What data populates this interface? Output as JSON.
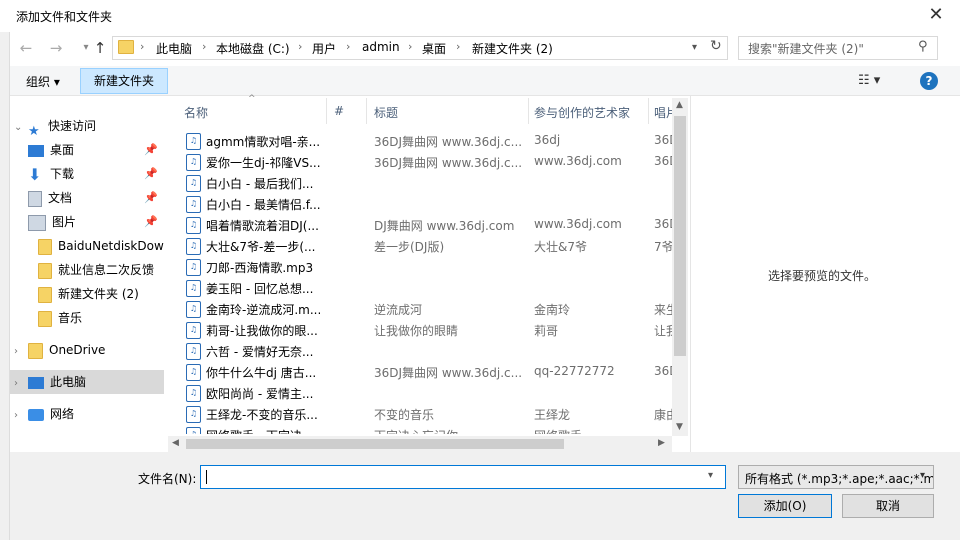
{
  "window": {
    "title": "添加文件和文件夹",
    "close_glyph": "✕"
  },
  "nav": {
    "back": "←",
    "forward": "→",
    "up": "↑",
    "refresh": "↻",
    "breadcrumb": [
      "此电脑",
      "本地磁盘 (C:)",
      "用户",
      "admin",
      "桌面",
      "新建文件夹 (2)"
    ],
    "search_placeholder": "搜索\"新建文件夹 (2)\""
  },
  "toolbar": {
    "organize": "组织 ▾",
    "new_folder": "新建文件夹",
    "view": "☷ ▾",
    "help": "?"
  },
  "sidebar": {
    "quick_access": "快速访问",
    "items": [
      {
        "label": "桌面",
        "icon": "desktop-icon",
        "pinned": true
      },
      {
        "label": "下载",
        "icon": "download-icon",
        "pinned": true
      },
      {
        "label": "文档",
        "icon": "document-icon",
        "pinned": true
      },
      {
        "label": "图片",
        "icon": "picture-icon",
        "pinned": true
      },
      {
        "label": "BaiduNetdiskDow",
        "icon": "folder-icon",
        "pinned": false
      },
      {
        "label": "就业信息二次反馈",
        "icon": "folder-icon",
        "pinned": false
      },
      {
        "label": "新建文件夹 (2)",
        "icon": "folder-icon",
        "pinned": false
      },
      {
        "label": "音乐",
        "icon": "folder-icon",
        "pinned": false
      }
    ],
    "onedrive": "OneDrive",
    "this_pc": "此电脑",
    "network": "网络",
    "pin_glyph": "📌"
  },
  "columns": {
    "name": "名称",
    "num": "#",
    "title": "标题",
    "artist": "参与创作的艺术家",
    "album": "唱片"
  },
  "files": [
    {
      "name": "agmm情歌对唱-亲...",
      "title": "36DJ舞曲网 www.36dj.c...",
      "artist": "36dj",
      "album": "36D"
    },
    {
      "name": "爱你一生dj-祁隆VS...",
      "title": "36DJ舞曲网 www.36dj.c...",
      "artist": "www.36dj.com",
      "album": "36D"
    },
    {
      "name": "白小白 - 最后我们...",
      "title": "",
      "artist": "",
      "album": ""
    },
    {
      "name": "白小白 - 最美情侣.f...",
      "title": "",
      "artist": "",
      "album": ""
    },
    {
      "name": "唱着情歌流着泪DJ(...",
      "title": "DJ舞曲网 www.36dj.com",
      "artist": "www.36dj.com",
      "album": "36D"
    },
    {
      "name": "大壮&7爷-差一步(...",
      "title": "差一步(DJ版)",
      "artist": "大壮&7爷",
      "album": "7爷"
    },
    {
      "name": "刀郎-西海情歌.mp3",
      "title": "",
      "artist": "",
      "album": ""
    },
    {
      "name": "姜玉阳 - 回忆总想...",
      "title": "",
      "artist": "",
      "album": ""
    },
    {
      "name": "金南玲-逆流成河.m...",
      "title": "逆流成河",
      "artist": "金南玲",
      "album": "来生"
    },
    {
      "name": "莉哥-让我做你的眼...",
      "title": "让我做你的眼睛",
      "artist": "莉哥",
      "album": "让我"
    },
    {
      "name": "六哲 - 爱情好无奈...",
      "title": "",
      "artist": "",
      "album": ""
    },
    {
      "name": "你牛什么牛dj 唐古...",
      "title": "36DJ舞曲网 www.36dj.c...",
      "artist": "qq-22772772",
      "album": "36D"
    },
    {
      "name": "欧阳尚尚 - 爱情主...",
      "title": "",
      "artist": "",
      "album": ""
    },
    {
      "name": "王绎龙-不变的音乐...",
      "title": "不变的音乐",
      "artist": "王绎龙",
      "album": "康由"
    },
    {
      "name": "网络歌手 - 下定决...",
      "title": "下定决心忘记你",
      "artist": "网络歌手",
      "album": ""
    }
  ],
  "preview": {
    "text": "选择要预览的文件。"
  },
  "bottom": {
    "filename_label": "文件名(N):",
    "filename_value": "",
    "filter": "所有格式 (*.mp3;*.ape;*.aac;*.m",
    "add_button": "添加(O)",
    "cancel_button": "取消"
  }
}
